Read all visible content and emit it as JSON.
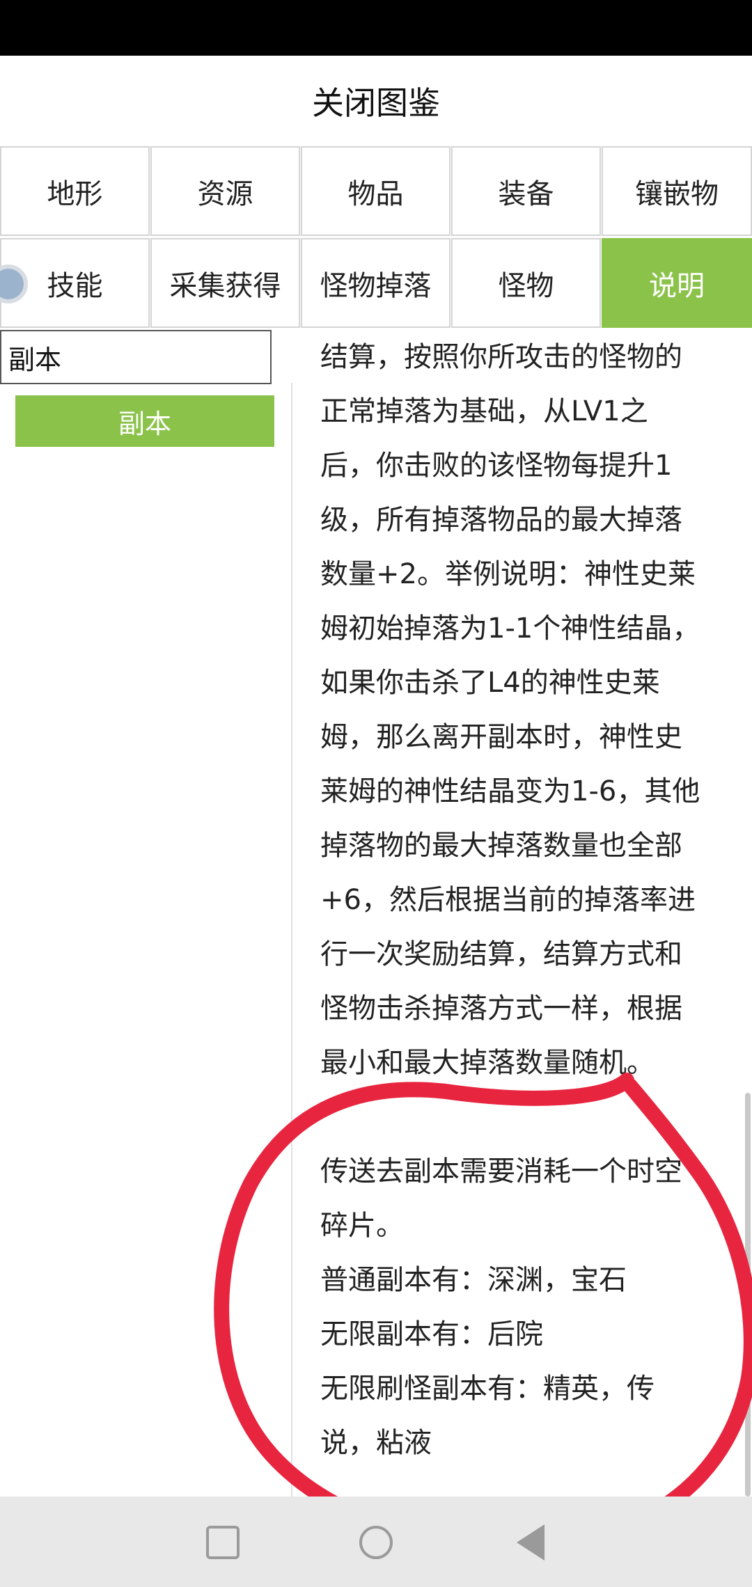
{
  "header": {
    "title": "关闭图鉴"
  },
  "tabs": {
    "row1": [
      "地形",
      "资源",
      "物品",
      "装备",
      "镶嵌物"
    ],
    "row2": [
      "技能",
      "采集获得",
      "怪物掉落",
      "怪物",
      "说明"
    ],
    "active": "说明"
  },
  "search": {
    "value": "副本"
  },
  "results": [
    {
      "label": "副本"
    }
  ],
  "content": {
    "lines": [
      "结算，按照你所攻击的怪物的",
      "正常掉落为基础，从LV1之",
      "后，你击败的该怪物每提升1",
      "级，所有掉落物品的最大掉落",
      "数量+2。举例说明：神性史莱",
      "姆初始掉落为1-1个神性结晶，",
      "如果你击杀了L4的神性史莱",
      "姆，那么离开副本时，神性史",
      "莱姆的神性结晶变为1-6，其他",
      "掉落物的最大掉落数量也全部",
      "+6，然后根据当前的掉落率进",
      "行一次奖励结算，结算方式和",
      "怪物击杀掉落方式一样，根据",
      "最小和最大掉落数量随机。",
      "",
      "传送去副本需要消耗一个时空",
      "碎片。",
      "普通副本有：深渊，宝石",
      "无限副本有：后院",
      "无限刷怪副本有：精英，传",
      "说，粘液"
    ]
  },
  "colors": {
    "accent": "#8bc34a",
    "annotation": "#e8253f"
  },
  "icons": [
    "avatar-icon",
    "recent-apps-icon",
    "home-icon",
    "back-icon"
  ]
}
